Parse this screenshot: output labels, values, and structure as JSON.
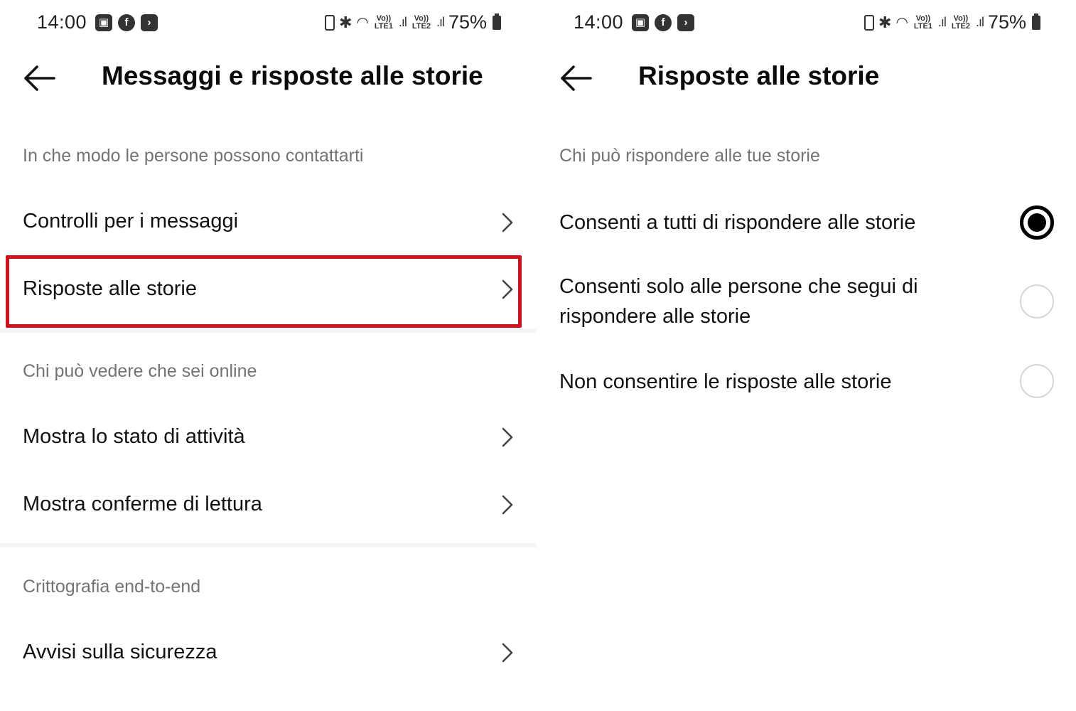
{
  "status_bar": {
    "time": "14:00",
    "left_icons": [
      "gallery-icon",
      "facebook-icon",
      "app-icon"
    ],
    "signal_labels": [
      "Vo)) LTE1",
      "Vo)) LTE2"
    ],
    "battery": "75%"
  },
  "left": {
    "header": {
      "title": "Messaggi e risposte alle storie"
    },
    "sections": [
      {
        "label": "In che modo le persone possono contattarti"
      },
      {
        "label": "Chi può vedere che sei online"
      },
      {
        "label": "Crittografia end-to-end"
      }
    ],
    "items": [
      {
        "label": "Controlli per i messaggi"
      },
      {
        "label": "Risposte alle storie",
        "highlighted": true
      },
      {
        "label": "Mostra lo stato di attività"
      },
      {
        "label": "Mostra conferme di lettura"
      },
      {
        "label": "Avvisi sulla sicurezza"
      }
    ]
  },
  "right": {
    "header": {
      "title": "Risposte alle storie"
    },
    "section": {
      "label": "Chi può rispondere alle tue storie"
    },
    "options": [
      {
        "label": "Consenti a tutti di rispondere alle storie",
        "selected": true
      },
      {
        "label": "Consenti solo alle persone che segui di rispondere alle storie",
        "selected": false
      },
      {
        "label": "Non consentire le risposte alle storie",
        "selected": false
      }
    ]
  },
  "colors": {
    "highlight_border": "#d0101d",
    "secondary_text": "#737373"
  }
}
